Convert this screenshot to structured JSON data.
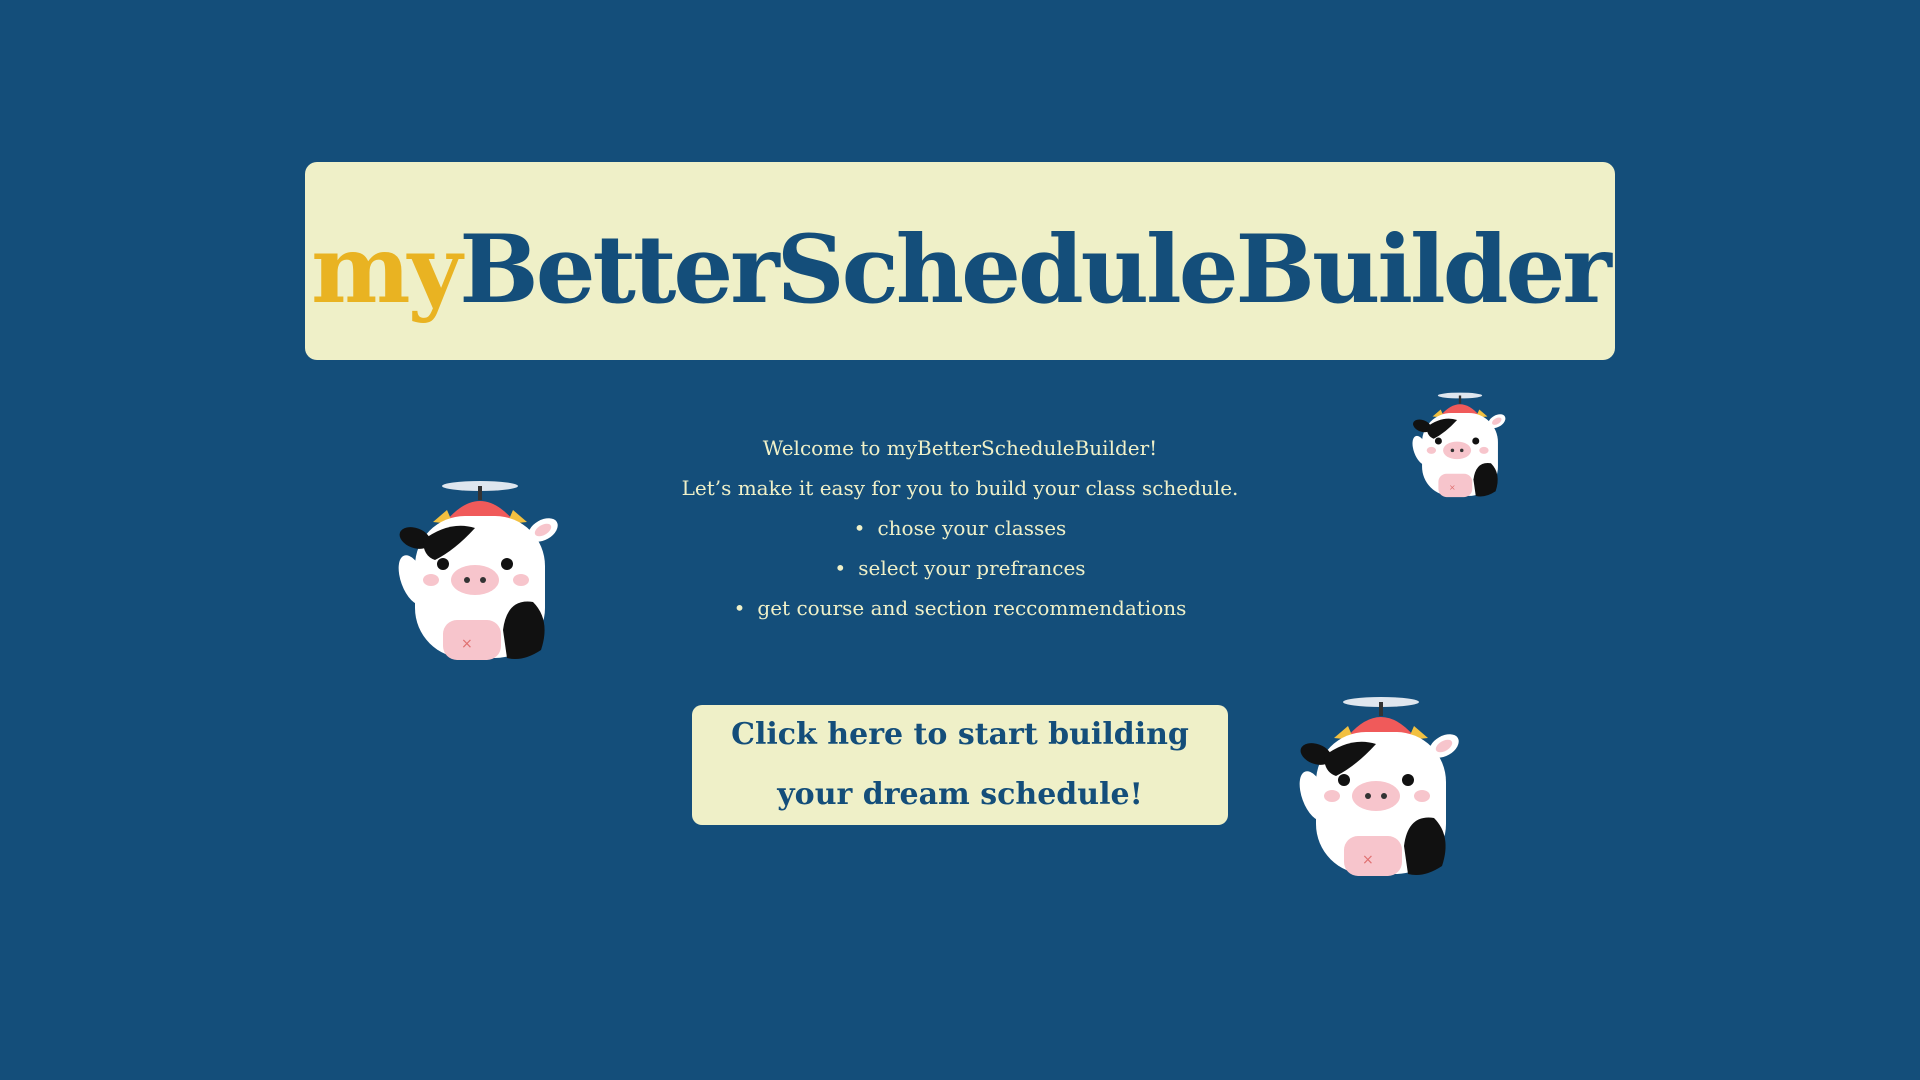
{
  "header": {
    "title_prefix": "my",
    "title_main": "BetterScheduleBuilder",
    "prefix_color": "#e9b322",
    "main_color": "#144e7a",
    "banner_color": "#eff0c8"
  },
  "intro": {
    "welcome": "Welcome to myBetterScheduleBuilder!",
    "tagline": "Let’s make it easy for you to build your class schedule.",
    "features": [
      "chose your classes",
      "select your prefrances",
      "get course and section reccommendations"
    ]
  },
  "cta": {
    "label": "Click here to start building your dream schedule!"
  },
  "decorations": {
    "mascot_icon": "propeller-hat-cow-icon"
  },
  "colors": {
    "background": "#144e7a",
    "text_light": "#eff0c8"
  }
}
